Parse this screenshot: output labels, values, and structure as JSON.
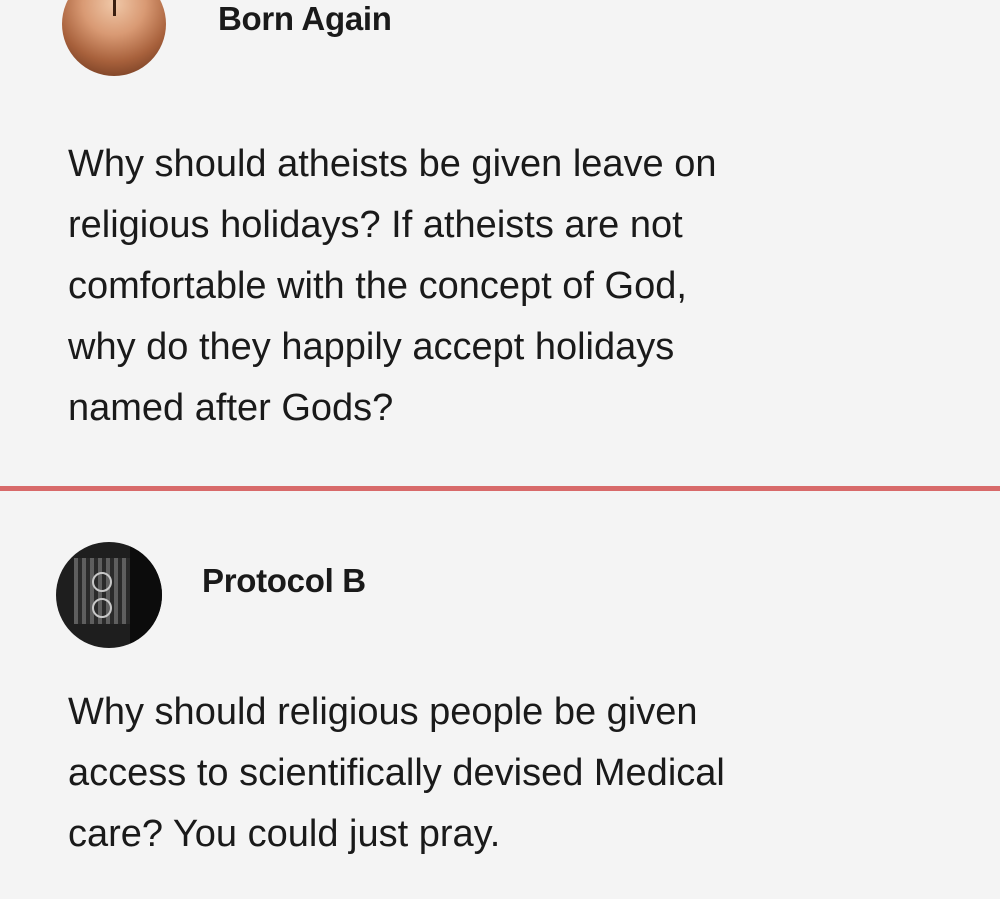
{
  "posts": [
    {
      "username": "Born Again",
      "lines": [
        "Why should atheists be given leave on",
        "religious holidays? If atheists are not",
        "comfortable with the concept of God,",
        "why do they happily accept holidays",
        "named after Gods?"
      ]
    },
    {
      "username": "Protocol B",
      "lines": [
        "Why should religious people be given",
        "access to scientifically devised Medical",
        "care? You could just pray."
      ]
    }
  ],
  "colors": {
    "background": "#f4f4f4",
    "divider": "#d86a6a",
    "text": "#1a1a1a"
  }
}
